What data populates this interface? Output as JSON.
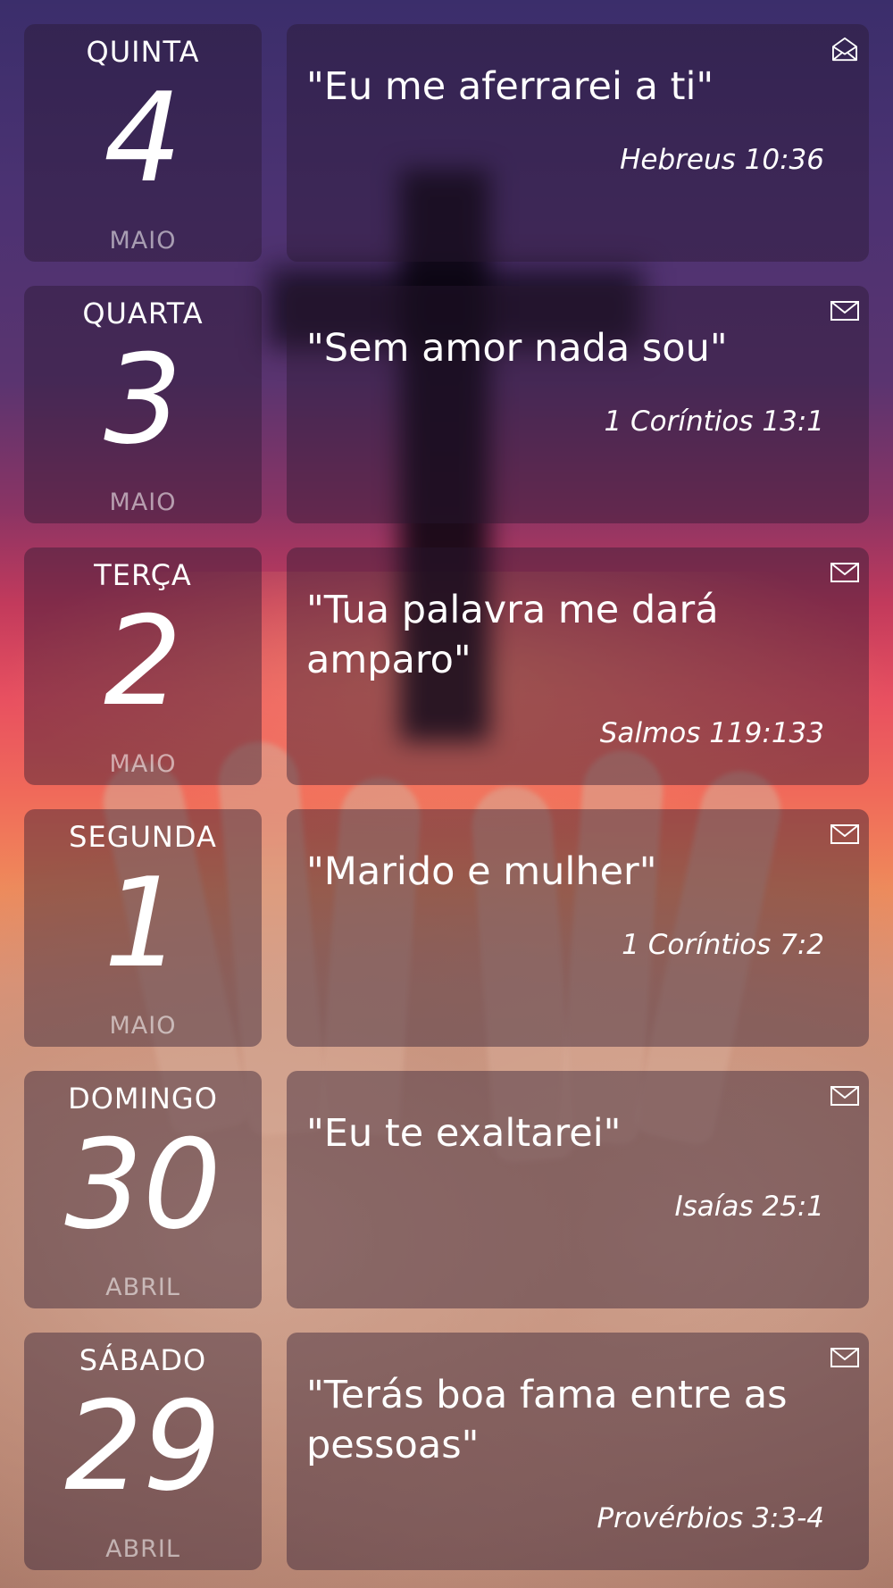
{
  "entries": [
    {
      "weekday": "QUINTA",
      "day": "4",
      "month": "MAIO",
      "verse": "\"Eu me aferrarei a ti\"",
      "reference": "Hebreus 10:36",
      "icon": "open-envelope-icon"
    },
    {
      "weekday": "QUARTA",
      "day": "3",
      "month": "MAIO",
      "verse": "\"Sem amor nada sou\"",
      "reference": "1 Coríntios 13:1",
      "icon": "envelope-icon"
    },
    {
      "weekday": "TERÇA",
      "day": "2",
      "month": "MAIO",
      "verse": "\"Tua palavra me dará amparo\"",
      "reference": "Salmos 119:133",
      "icon": "envelope-icon"
    },
    {
      "weekday": "SEGUNDA",
      "day": "1",
      "month": "MAIO",
      "verse": "\"Marido e mulher\"",
      "reference": "1 Coríntios 7:2",
      "icon": "envelope-icon"
    },
    {
      "weekday": "DOMINGO",
      "day": "30",
      "month": "ABRIL",
      "verse": "\"Eu te exaltarei\"",
      "reference": "Isaías 25:1",
      "icon": "envelope-icon"
    },
    {
      "weekday": "SÁBADO",
      "day": "29",
      "month": "ABRIL",
      "verse": "\"Terás boa fama entre as pessoas\"",
      "reference": "Provérbios 3:3-4",
      "icon": "envelope-icon"
    }
  ]
}
